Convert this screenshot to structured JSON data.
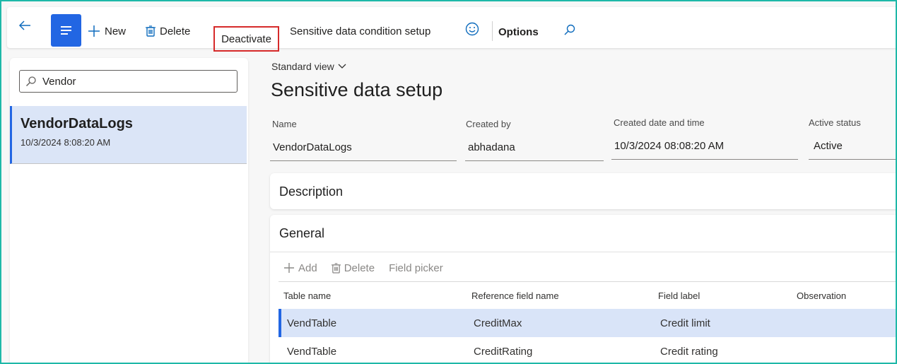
{
  "toolbar": {
    "new_label": "New",
    "delete_label": "Delete",
    "deactivate_label": "Deactivate",
    "sensitive_label": "Sensitive data condition setup",
    "options_label": "Options",
    "accent_color": "#2266e3",
    "highlight_color": "#d62a2a"
  },
  "search": {
    "value": "Vendor"
  },
  "list": {
    "items": [
      {
        "title": "VendorDataLogs",
        "subtitle": "10/3/2024 8:08:20 AM"
      }
    ]
  },
  "main": {
    "view_label": "Standard view",
    "title": "Sensitive data setup",
    "fields": {
      "name_label": "Name",
      "name_value": "VendorDataLogs",
      "created_by_label": "Created by",
      "created_by_value": "abhadana",
      "created_dt_label": "Created date and time",
      "created_dt_value": "10/3/2024 08:08:20 AM",
      "active_status_label": "Active status",
      "active_status_value": "Active"
    },
    "description_title": "Description",
    "general_title": "General",
    "actions": {
      "add": "Add",
      "delete": "Delete",
      "field_picker": "Field picker"
    },
    "grid": {
      "headers": [
        "Table name",
        "Reference field name",
        "Field label",
        "Observation"
      ],
      "rows": [
        {
          "table": "VendTable",
          "ref": "CreditMax",
          "label": "Credit limit",
          "obs": ""
        },
        {
          "table": "VendTable",
          "ref": "CreditRating",
          "label": "Credit rating",
          "obs": ""
        }
      ]
    }
  }
}
